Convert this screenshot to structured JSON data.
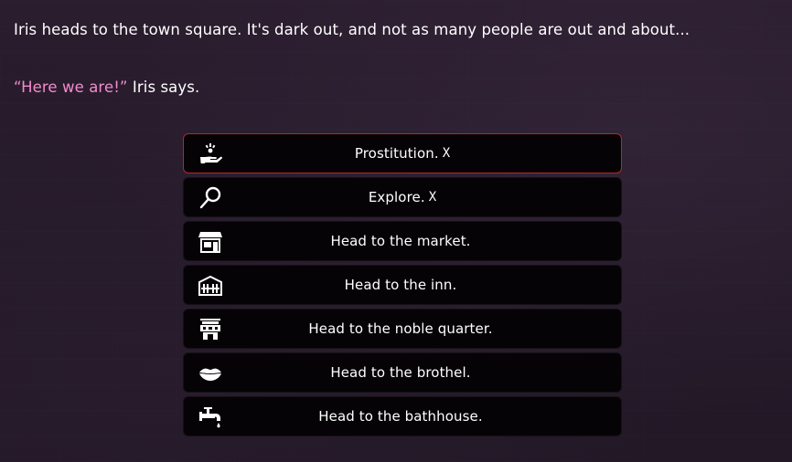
{
  "story": {
    "narration": "Iris heads to the town square. It's dark out, and not as many people are out and about...",
    "dialogue_quote": "“Here we are!”",
    "dialogue_tag": " Iris says."
  },
  "choices": [
    {
      "label": "Prostitution.",
      "marker": "X",
      "icon": "hand-coin-icon",
      "selected": true
    },
    {
      "label": "Explore.",
      "marker": "X",
      "icon": "magnifier-icon",
      "selected": false
    },
    {
      "label": "Head to the market.",
      "marker": "",
      "icon": "market-stall-icon",
      "selected": false
    },
    {
      "label": "Head to the inn.",
      "marker": "",
      "icon": "inn-building-icon",
      "selected": false
    },
    {
      "label": "Head to the noble quarter.",
      "marker": "",
      "icon": "noble-house-icon",
      "selected": false
    },
    {
      "label": "Head to the brothel.",
      "marker": "",
      "icon": "lips-icon",
      "selected": false
    },
    {
      "label": "Head to the bathhouse.",
      "marker": "",
      "icon": "faucet-icon",
      "selected": false
    }
  ],
  "colors": {
    "quote": "#f28ccd",
    "selected_border": "#b8262e",
    "button_bg": "#050305"
  }
}
